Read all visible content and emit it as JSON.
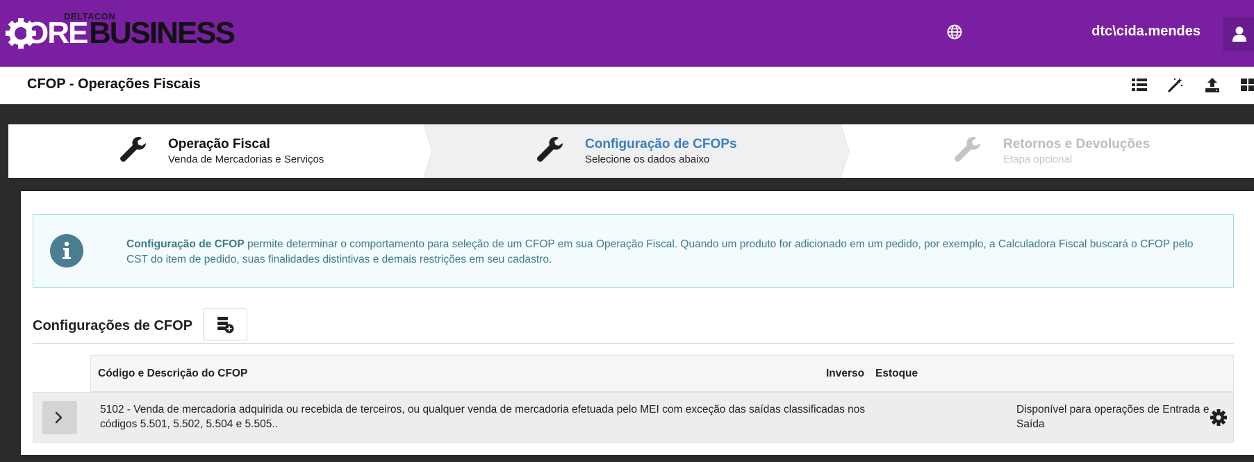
{
  "brand": {
    "small": "DELTACON",
    "ore": "ORE",
    "business": "BUSINESS"
  },
  "user": {
    "name": "dtc\\cida.mendes"
  },
  "page": {
    "title": "CFOP - Operações Fiscais"
  },
  "steps": [
    {
      "title": "Operação Fiscal",
      "subtitle": "Venda de Mercadorias e Serviços"
    },
    {
      "title": "Configuração de CFOPs",
      "subtitle": "Selecione os dados abaixo"
    },
    {
      "title": "Retornos e Devoluções",
      "subtitle": "Etapa opcional"
    }
  ],
  "alert": {
    "strong": "Configuração de CFOP",
    "text": " permite determinar o comportamento para seleção de um CFOP em sua Operação Fiscal. Quando um produto for adicionado em um pedido, por exemplo, a Calculadora Fiscal buscará o CFOP pelo CST do item de pedido, suas finalidades distintivas e demais restrições em seu cadastro."
  },
  "section": {
    "title": "Configurações de CFOP"
  },
  "table": {
    "columns": {
      "code_desc": "Código e Descrição do CFOP",
      "inverse": "Inverso",
      "stock": "Estoque"
    },
    "rows": [
      {
        "code_desc": "5102 - Venda de mercadoria adquirida ou recebida de terceiros, ou qualquer venda de mercadoria efetuada pelo MEI com exceção das saídas classificadas nos códigos 5.501, 5.502, 5.504 e 5.505..",
        "inverse": "",
        "stock": "Disponível para operações de Entrada e Saída"
      }
    ]
  },
  "colors": {
    "topbar": "#7b1fa2",
    "active_step": "#3a7dc2",
    "inactive_step": "#bdbdbd",
    "info_text": "#3d7a8c",
    "info_bg": "#f3fbfc"
  },
  "icons": [
    "globe-icon",
    "user-icon",
    "list-icon",
    "magic-wand-icon",
    "upload-icon",
    "grid-icon",
    "wrench-icon",
    "info-icon",
    "database-add-icon",
    "chevron-right-icon",
    "cog-icon"
  ]
}
